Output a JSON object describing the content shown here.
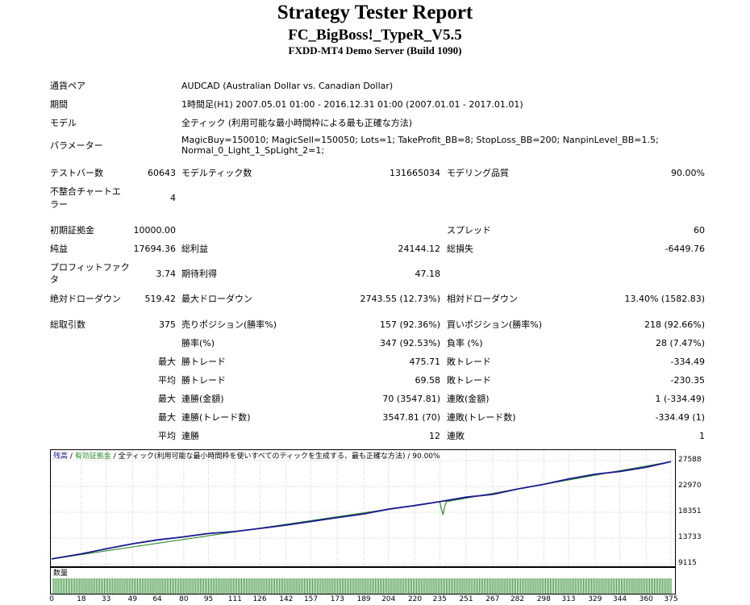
{
  "report": {
    "title": "Strategy Tester Report",
    "ea_name": "FC_BigBoss!_TypeR_V5.5",
    "server": "FXDD-MT4 Demo Server (Build 1090)"
  },
  "settings": {
    "symbol_label": "通貨ペア",
    "symbol_value": "AUDCAD (Australian Dollar vs. Canadian Dollar)",
    "period_label": "期間",
    "period_value": "1時間足(H1) 2007.05.01 01:00 - 2016.12.31 01:00 (2007.01.01 - 2017.01.01)",
    "model_label": "モデル",
    "model_value": "全ティック (利用可能な最小時間枠による最も正確な方法)",
    "params_label": "パラメーター",
    "params_line1": "MagicBuy=150010; MagicSell=150050; Lots=1; TakeProfit_BB=8; StopLoss_BB=200; NanpinLevel_BB=1.5;",
    "params_line2": "Normal_0_Light_1_SpLight_2=1;"
  },
  "stats": {
    "bars_label": "テストバー数",
    "bars_value": "60643",
    "ticks_label": "モデルティック数",
    "ticks_value": "131665034",
    "quality_label": "モデリング品質",
    "quality_value": "90.00%",
    "mismatch_label_1": "不整合チャートエ",
    "mismatch_label_2": "ラー",
    "mismatch_value": "4",
    "deposit_label": "初期証拠金",
    "deposit_value": "10000.00",
    "spread_label": "スプレッド",
    "spread_value": "60",
    "net_label": "純益",
    "net_value": "17694.36",
    "gross_profit_label": "総利益",
    "gross_profit_value": "24144.12",
    "gross_loss_label": "総損失",
    "gross_loss_value": "-6449.76",
    "pf_label_1": "プロフィットファク",
    "pf_label_2": "タ",
    "pf_value": "3.74",
    "expected_label": "期待利得",
    "expected_value": "47.18",
    "abs_dd_label": "絶対ドローダウン",
    "abs_dd_value": "519.42",
    "max_dd_label": "最大ドローダウン",
    "max_dd_value": "2743.55 (12.73%)",
    "rel_dd_label": "相対ドローダウン",
    "rel_dd_value": "13.40% (1582.83)",
    "total_trades_label": "総取引数",
    "total_trades_value": "375",
    "short_label": "売りポジション(勝率%)",
    "short_value": "157 (92.36%)",
    "long_label": "買いポジション(勝率%)",
    "long_value": "218 (92.66%)",
    "win_rate_label": "勝率(%)",
    "win_rate_value": "347 (92.53%)",
    "loss_rate_label": "負率 (%)",
    "loss_rate_value": "28 (7.47%)",
    "max_label": "最大",
    "avg_label": "平均",
    "largest_win_label": "勝トレード",
    "largest_win_value": "475.71",
    "largest_loss_label": "敗トレード",
    "largest_loss_value": "-334.49",
    "avg_win_label": "勝トレード",
    "avg_win_value": "69.58",
    "avg_loss_label": "敗トレード",
    "avg_loss_value": "-230.35",
    "max_cons_wins_amt_label": "連勝(金額)",
    "max_cons_wins_amt_value": "70 (3547.81)",
    "max_cons_losses_amt_label": "連敗(金額)",
    "max_cons_losses_amt_value": "1 (-334.49)",
    "max_cons_wins_cnt_label": "連勝(トレード数)",
    "max_cons_wins_cnt_value": "3547.81 (70)",
    "max_cons_losses_cnt_label": "連敗(トレード数)",
    "max_cons_losses_cnt_value": "-334.49 (1)",
    "avg_cons_wins_label": "連勝",
    "avg_cons_wins_value": "12",
    "avg_cons_losses_label": "連敗",
    "avg_cons_losses_value": "1"
  },
  "chart_legend": {
    "balance": "残高",
    "sep1": " / ",
    "equity": "有効証拠金",
    "sep2": " / ",
    "model": "全ティック(利用可能な最小時間枠を使いすべてのティックを生成する、最も正確な方法) / 90.00%"
  },
  "volume_label": "数量",
  "colors": {
    "balance": "#1a1a8c",
    "equity": "#2e8b2e",
    "volume": "#2e8b2e",
    "grid": "#c8c8c8"
  },
  "chart_data": {
    "type": "line",
    "x_ticks": [
      0,
      18,
      33,
      49,
      64,
      80,
      95,
      111,
      126,
      142,
      157,
      173,
      189,
      204,
      220,
      235,
      251,
      267,
      282,
      298,
      313,
      329,
      344,
      360,
      375
    ],
    "y_ticks": [
      9115,
      13733,
      18351,
      22970,
      27588
    ],
    "xlim": [
      0,
      375
    ],
    "ylim": [
      9115,
      27588
    ],
    "series": [
      {
        "name": "残高",
        "x": [
          0,
          18,
          33,
          49,
          64,
          80,
          95,
          111,
          126,
          142,
          157,
          173,
          189,
          204,
          220,
          235,
          251,
          267,
          282,
          298,
          313,
          329,
          344,
          360,
          375
        ],
        "y": [
          10000,
          10900,
          11800,
          12700,
          13400,
          13950,
          14550,
          14900,
          15450,
          16050,
          16700,
          17400,
          18050,
          18900,
          19550,
          20250,
          21050,
          21550,
          22500,
          23350,
          24300,
          25150,
          25650,
          26400,
          27400
        ]
      },
      {
        "name": "有効証拠金",
        "x": [
          0,
          235,
          236,
          237,
          238,
          239,
          240,
          375
        ],
        "y": [
          10000,
          20250,
          18900,
          17900,
          19400,
          20250,
          20300,
          27400
        ]
      }
    ],
    "volume": {
      "x_start": 1,
      "x_end": 375,
      "value": 1,
      "max": 1
    }
  }
}
